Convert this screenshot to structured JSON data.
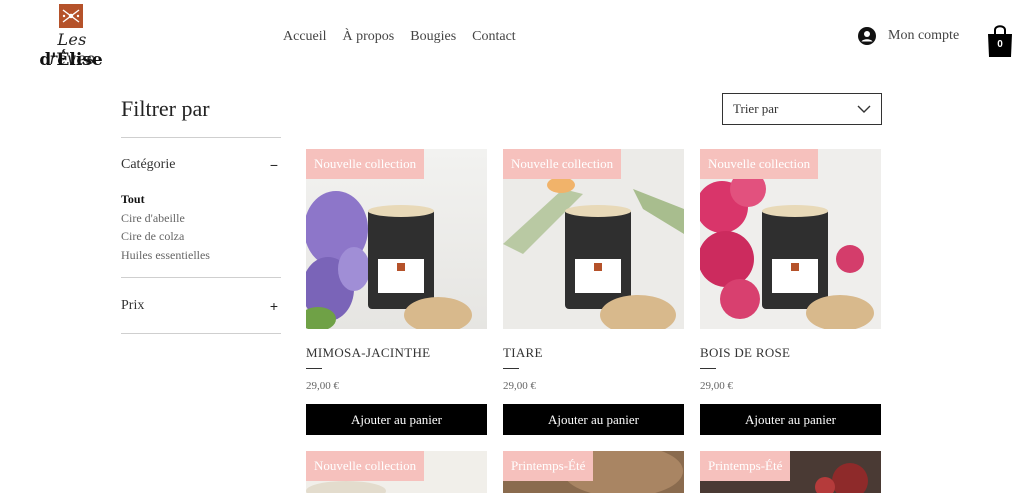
{
  "brand": {
    "logo_line1": "Les rêves",
    "logo_line2": "d'Élise"
  },
  "nav": {
    "items": [
      "Accueil",
      "À propos",
      "Bougies",
      "Contact"
    ]
  },
  "account": {
    "label": "Mon compte"
  },
  "cart": {
    "count": "0"
  },
  "filters": {
    "title": "Filtrer par",
    "category": {
      "label": "Catégorie",
      "toggle": "−",
      "items": [
        "Tout",
        "Cire d'abeille",
        "Cire de colza",
        "Huiles essentielles"
      ],
      "active": "Tout"
    },
    "price": {
      "label": "Prix",
      "toggle": "+"
    }
  },
  "sort": {
    "label": "Trier par"
  },
  "products": [
    {
      "badge": "Nouvelle collection",
      "name": "MIMOSA-JACINTHE",
      "price": "29,00 €",
      "button": "Ajouter au panier"
    },
    {
      "badge": "Nouvelle collection",
      "name": "TIARE",
      "price": "29,00 €",
      "button": "Ajouter au panier"
    },
    {
      "badge": "Nouvelle collection",
      "name": "BOIS DE ROSE",
      "price": "29,00 €",
      "button": "Ajouter au panier"
    },
    {
      "badge": "Nouvelle collection"
    },
    {
      "badge": "Printemps-Été"
    },
    {
      "badge": "Printemps-Été"
    }
  ],
  "colors": {
    "badge": "#f6c1bd",
    "button": "#000000",
    "logo_emblem": "#b5522a"
  }
}
